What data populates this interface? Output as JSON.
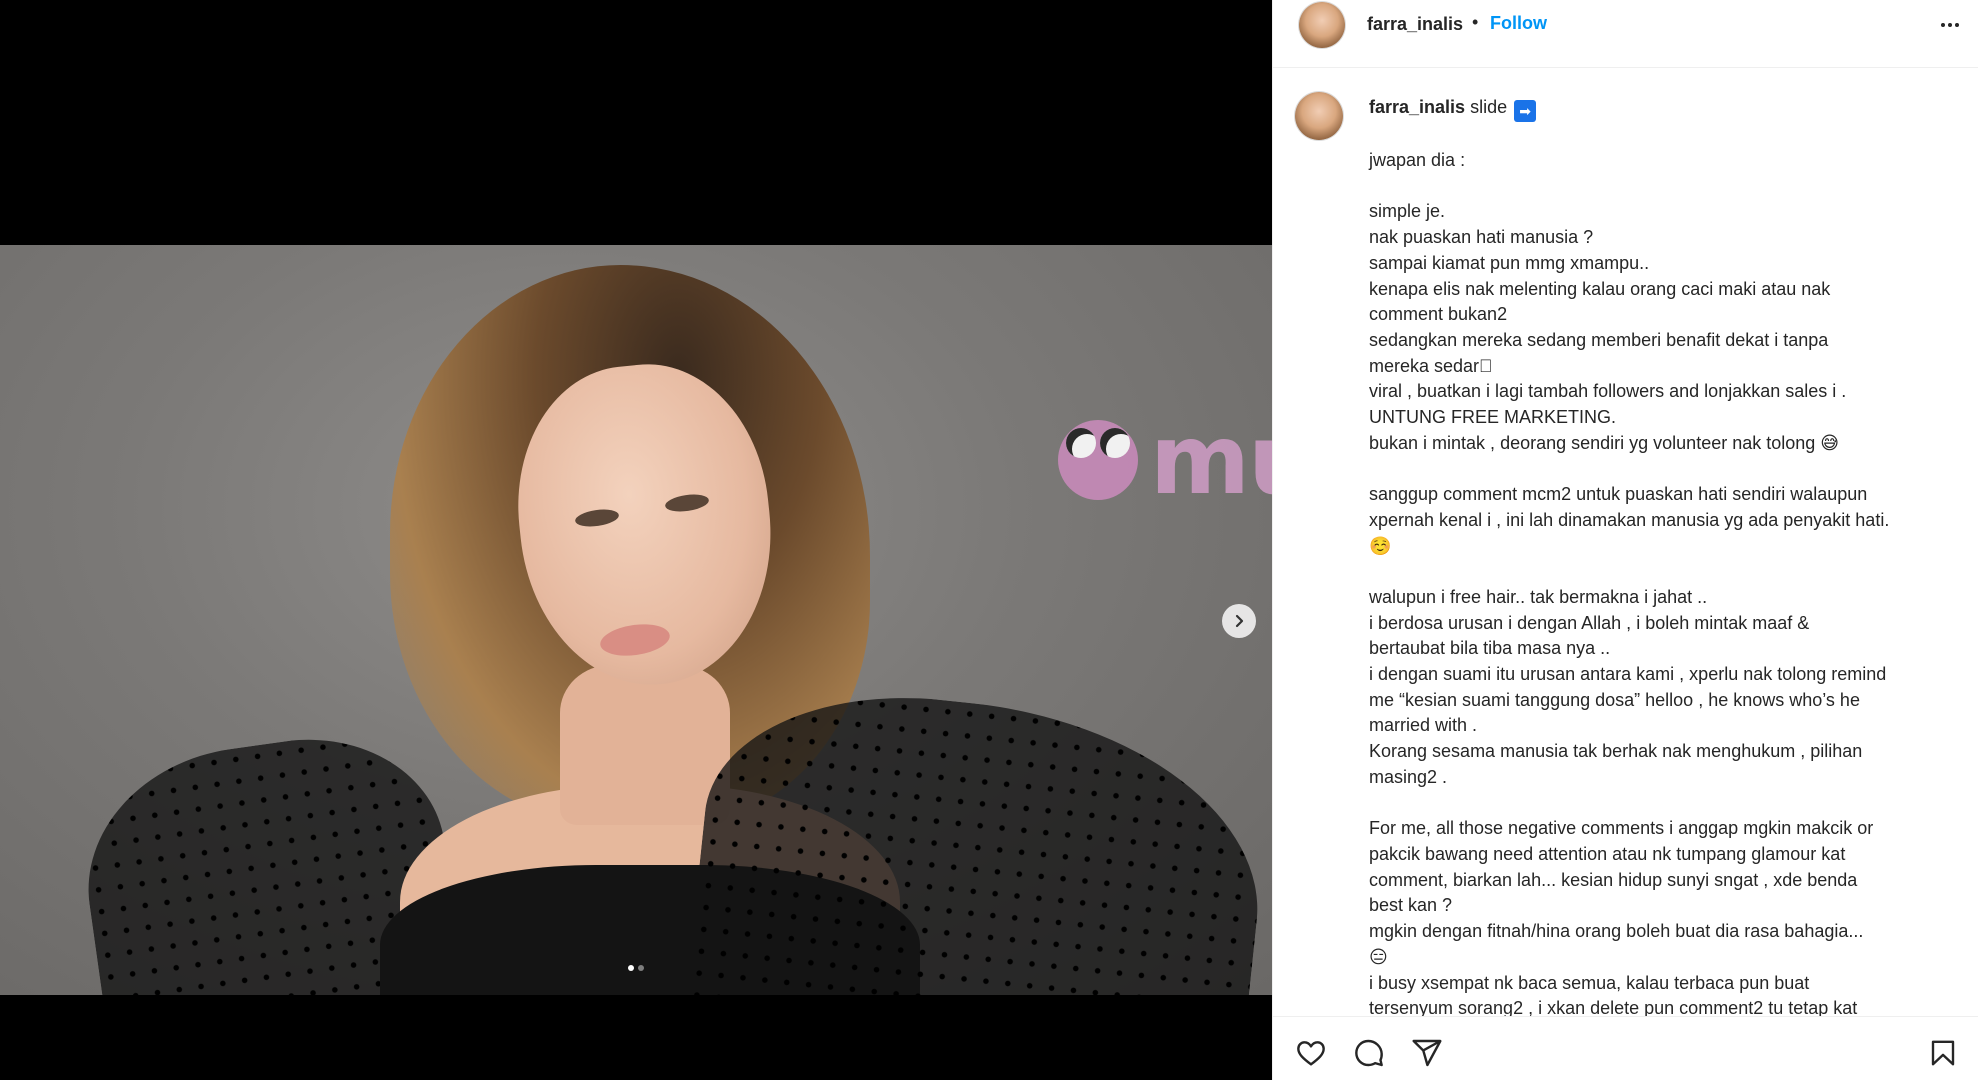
{
  "post": {
    "username": "farra_inalis",
    "separator": "•",
    "follow_label": "Follow",
    "caption_head_text": "slide",
    "caption_lines": [
      "jwapan dia :",
      "",
      "simple je.",
      "nak puaskan hati manusia ?",
      "sampai kiamat pun mmg xmampu..",
      "kenapa elis nak melenting kalau orang caci maki atau nak",
      "comment bukan2",
      "sedangkan mereka sedang memberi benafit dekat i tanpa",
      "mereka sedar􏿽",
      "viral , buatkan i lagi tambah followers and lonjakkan sales i .",
      "UNTUNG FREE MARKETING.",
      "bukan i mintak , deorang sendiri yg volunteer nak tolong 😅",
      "",
      "sanggup comment mcm2 untuk puaskan hati sendiri walaupun",
      "xpernah kenal i , ini lah dinamakan manusia yg ada penyakit hati.",
      "☺️",
      "",
      "walupun i free hair.. tak bermakna i jahat ..",
      "i berdosa urusan i dengan Allah , i boleh mintak maaf &",
      "bertaubat bila tiba masa nya ..",
      "i dengan suami itu urusan antara kami , xperlu nak tolong remind",
      "me “kesian suami tanggung dosa” helloo , he knows who’s he",
      "married with .",
      "Korang sesama manusia tak berhak nak menghukum , pilihan",
      "masing2 .",
      "",
      "For me, all those negative comments i anggap mgkin makcik or",
      "pakcik bawang need attention atau nk tumpang glamour kat",
      "comment, biarkan lah... kesian hidup sunyi sngat , xde benda",
      "best kan ?",
      "mgkin dengan fitnah/hina orang boleh buat dia rasa bahagia...",
      "😑",
      "i busy xsempat nk baca semua, kalau terbaca pun buat",
      "tersenyum sorang2 , i xkan delete pun comment2 tu tetap kat"
    ]
  },
  "media": {
    "watermark_text": "murai",
    "carousel_total": 2,
    "carousel_active": 1
  },
  "icons": {
    "more": "more-horizontal-icon",
    "next": "chevron-right-icon",
    "like": "heart-icon",
    "comment": "comment-icon",
    "share": "share-icon",
    "save": "bookmark-icon",
    "arrow_emoji": "right-arrow-emoji-icon"
  },
  "colors": {
    "follow": "#0095f6",
    "text": "#262626",
    "border": "#efefef",
    "watermark": "#d7a0cd"
  }
}
